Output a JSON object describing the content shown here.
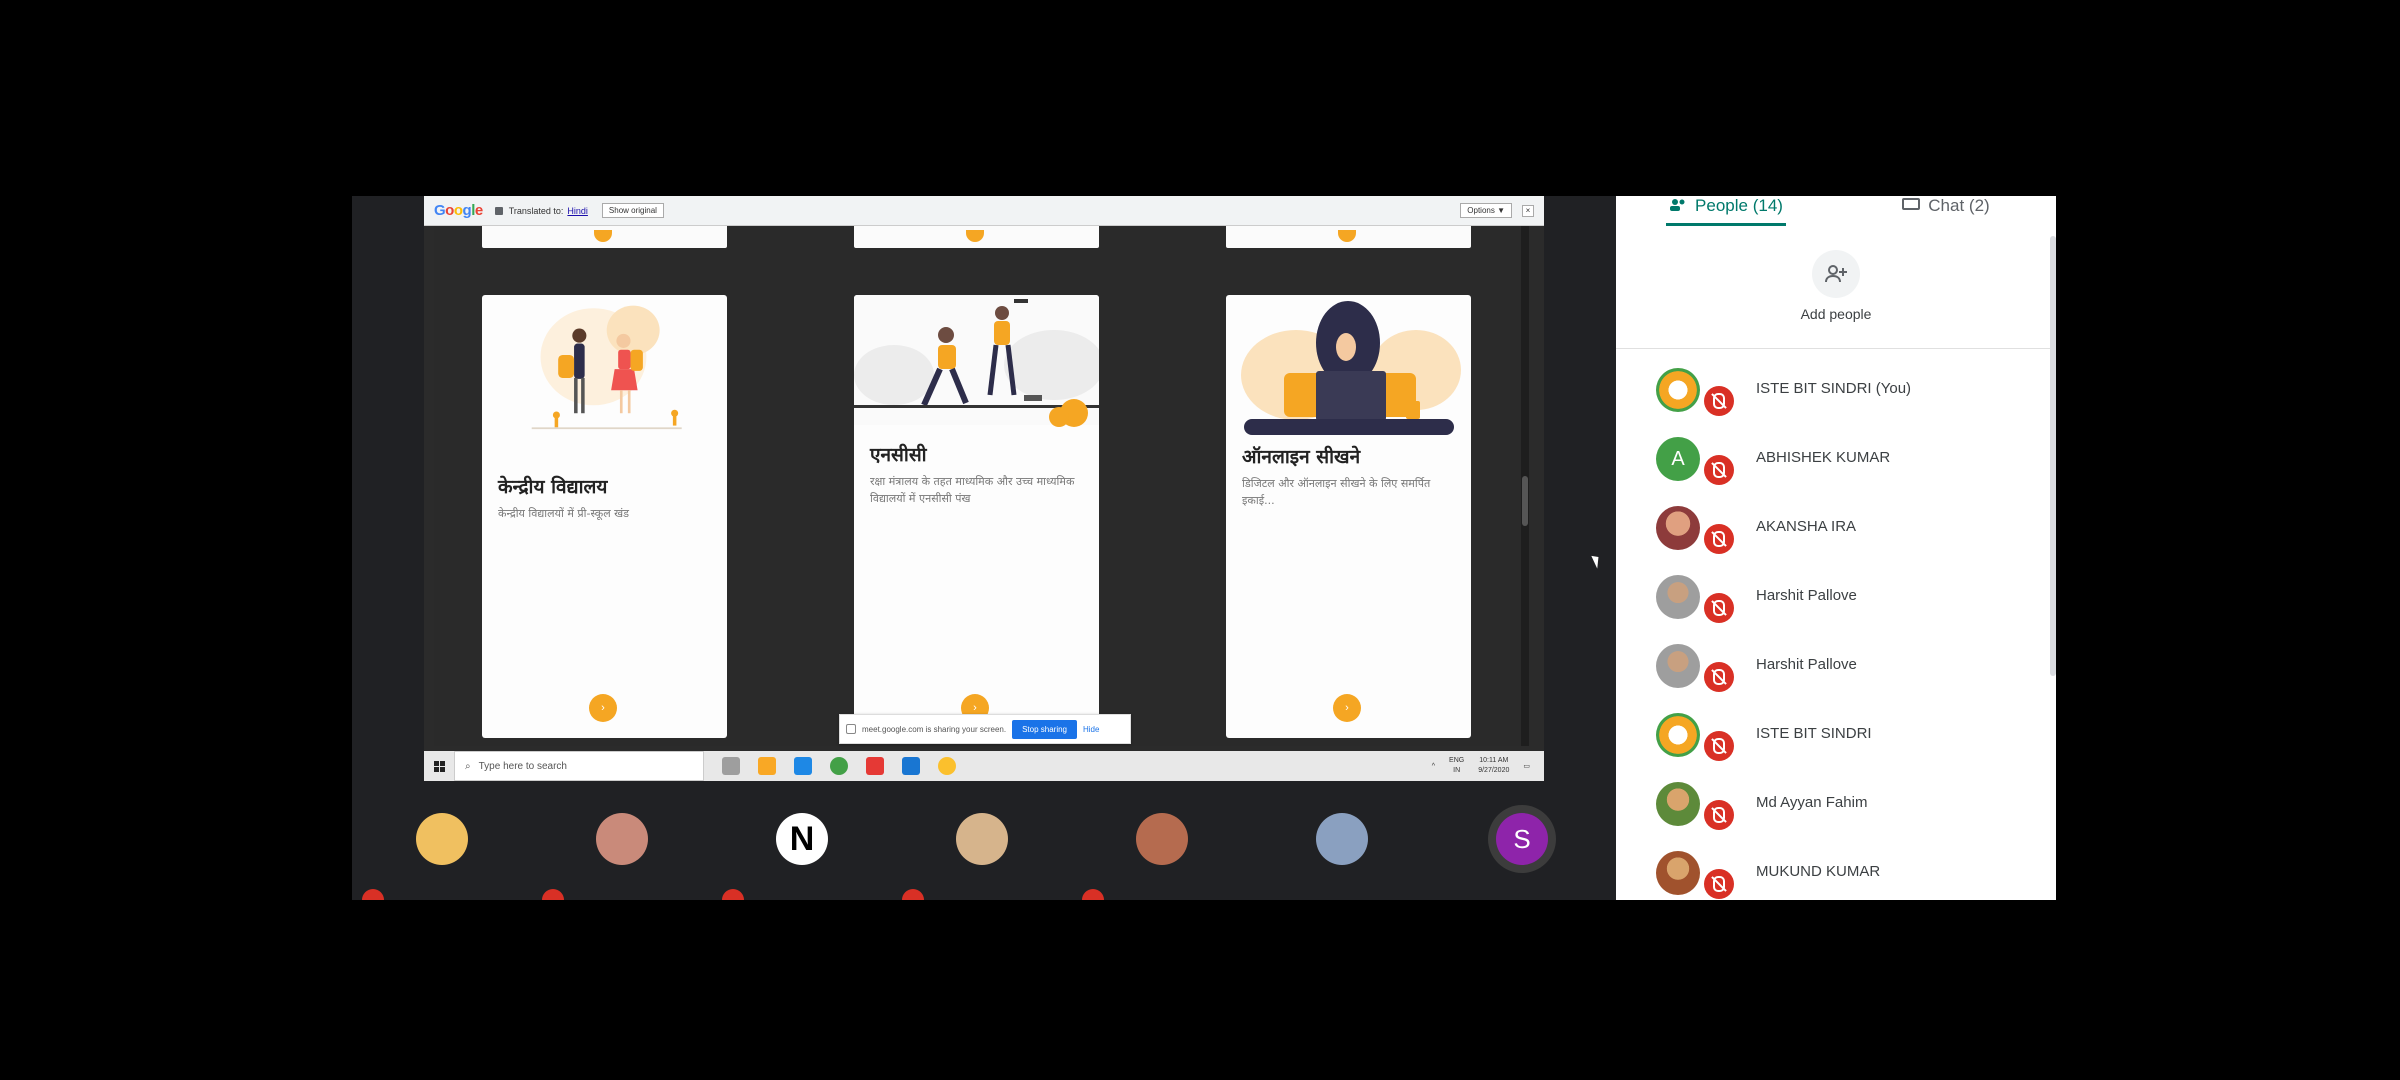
{
  "translate_bar": {
    "logo_letters": [
      "G",
      "o",
      "o",
      "g",
      "l",
      "e"
    ],
    "translated_to_label": "Translated to:",
    "language": "Hindi",
    "show_original": "Show original",
    "options": "Options ▼",
    "close": "×"
  },
  "cards": [
    {
      "title": "केन्द्रीय विद्यालय",
      "description": "केन्द्रीय विद्यालयों में प्री-स्कूल खंड"
    },
    {
      "title": "एनसीसी",
      "description": "रक्षा मंत्रालय के तहत माध्यमिक और उच्च माध्यमिक विद्यालयों में एनसीसी पंख"
    },
    {
      "title": "ऑनलाइन सीखने",
      "description": "डिजिटल और ऑनलाइन सीखने के लिए समर्पित इकाई..."
    }
  ],
  "share_bar": {
    "message": "meet.google.com is sharing your screen.",
    "stop": "Stop sharing",
    "hide": "Hide"
  },
  "taskbar": {
    "search_placeholder": "Type here to search",
    "lang_top": "ENG",
    "lang_bottom": "IN",
    "time": "10:11 AM",
    "date": "9/27/2020"
  },
  "strip": {
    "tile_letter": "N",
    "self_letter": "S"
  },
  "panel": {
    "people_tab": "People (14)",
    "chat_tab": "Chat (2)",
    "add_people": "Add people",
    "participants": [
      {
        "name": "ISTE BIT SINDRI (You)",
        "avatar": "photo"
      },
      {
        "name": "ABHISHEK KUMAR",
        "avatar": "letter",
        "letter": "A"
      },
      {
        "name": "AKANSHA IRA",
        "avatar": "photo"
      },
      {
        "name": "Harshit Pallove",
        "avatar": "photo"
      },
      {
        "name": "Harshit Pallove",
        "avatar": "photo"
      },
      {
        "name": "ISTE BIT SINDRI",
        "avatar": "photo"
      },
      {
        "name": "Md Ayyan Fahim",
        "avatar": "photo"
      },
      {
        "name": "MUKUND KUMAR",
        "avatar": "photo"
      }
    ]
  },
  "colors": {
    "accent_orange": "#f5a623",
    "meet_teal": "#00796b",
    "mute_red": "#d93025",
    "stop_blue": "#1a73e8"
  }
}
